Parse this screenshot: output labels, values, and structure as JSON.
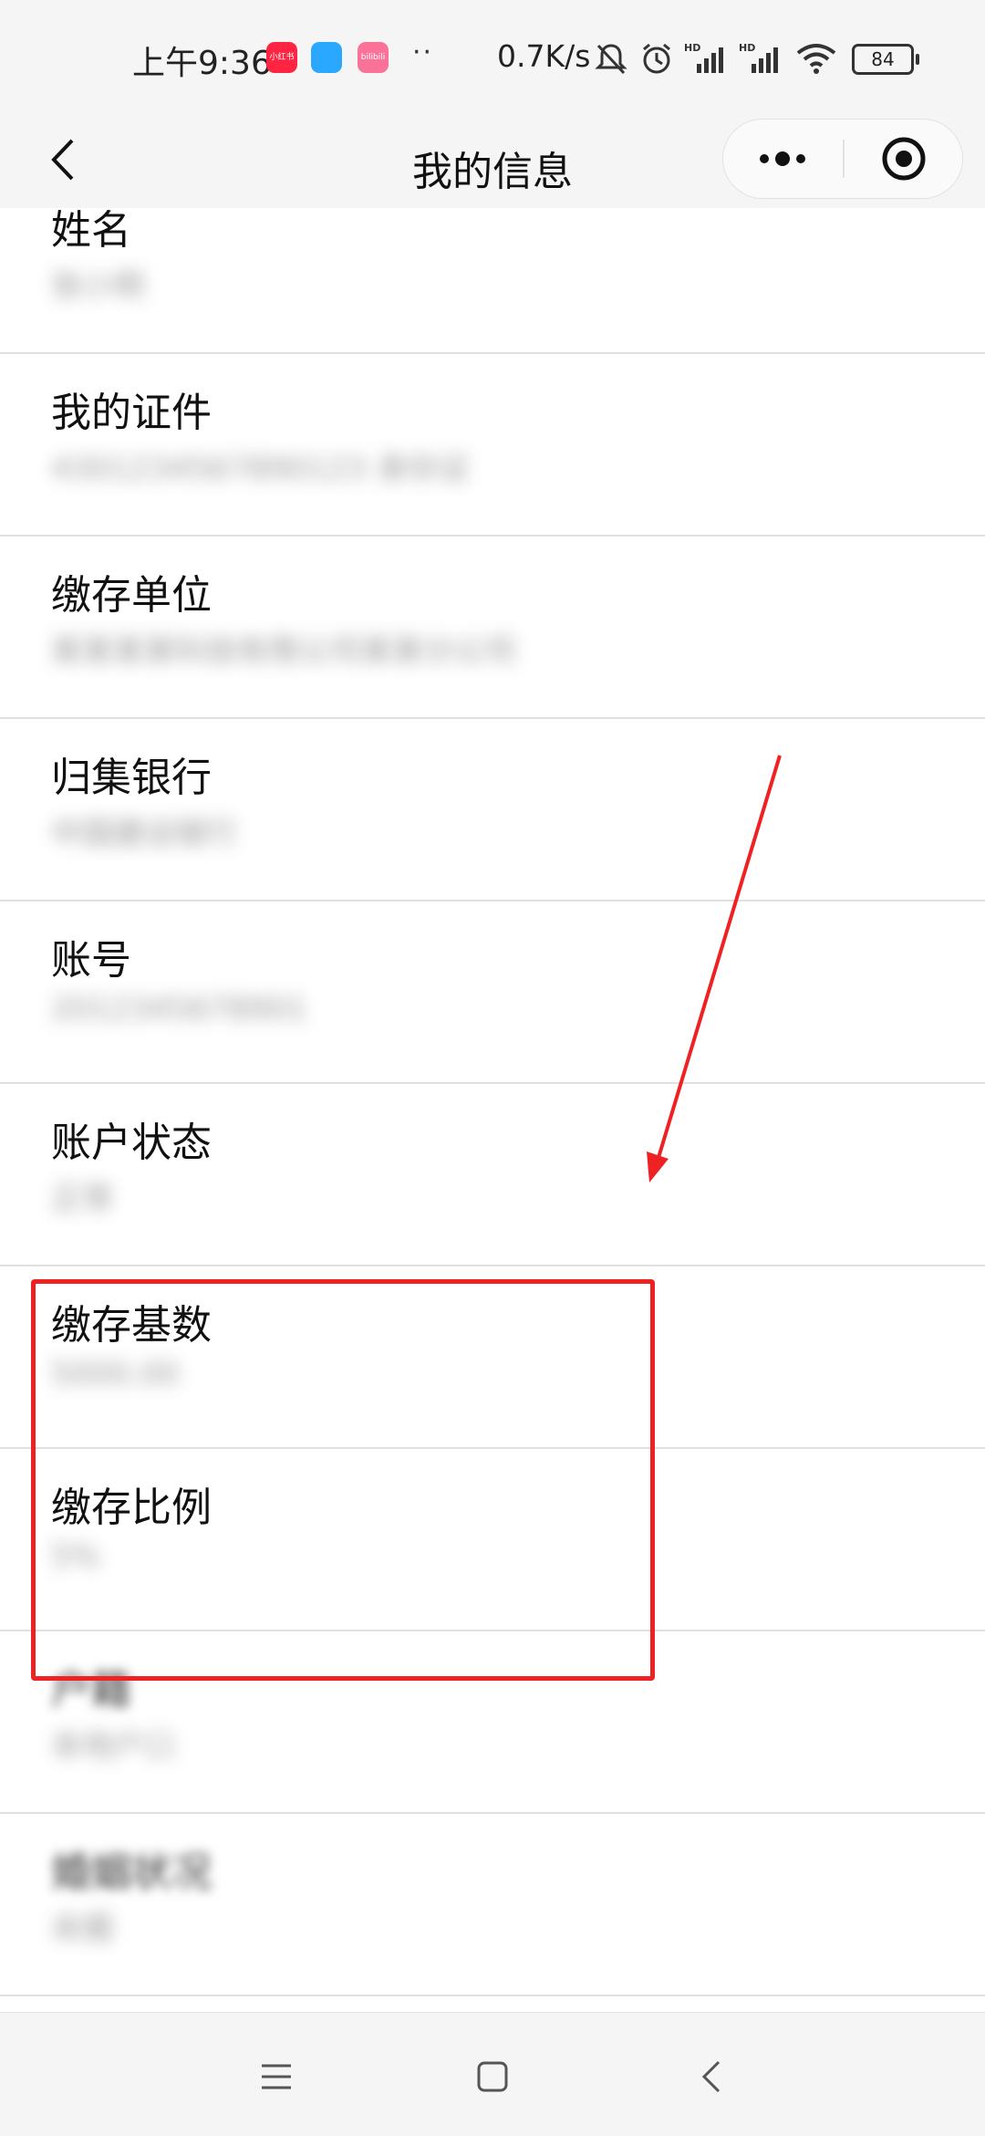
{
  "status_bar": {
    "time": "上午9:36",
    "apps": [
      "小红书",
      "",
      "bilibili"
    ],
    "dots": "··",
    "network_speed": "0.7K/s",
    "battery": "84"
  },
  "nav": {
    "title": "我的信息"
  },
  "list": {
    "items": [
      {
        "label": "姓名",
        "value": "张小明"
      },
      {
        "label": "我的证件",
        "value": "4301234567890123 身份证"
      },
      {
        "label": "缴存单位",
        "value": "某某某某科技有限公司某某分公司"
      },
      {
        "label": "归集银行",
        "value": "中国建设银行"
      },
      {
        "label": "账号",
        "value": "2012345678901"
      },
      {
        "label": "账户状态",
        "value": "正常"
      },
      {
        "label": "缴存基数",
        "value": "5000.00"
      },
      {
        "label": "缴存比例",
        "value": "5%"
      },
      {
        "label": "户籍",
        "value": "本地户口"
      },
      {
        "label": "婚姻状况",
        "value": "未婚"
      }
    ]
  },
  "colors": {
    "annotation": "#ee2222",
    "background": "#f5f5f5"
  }
}
